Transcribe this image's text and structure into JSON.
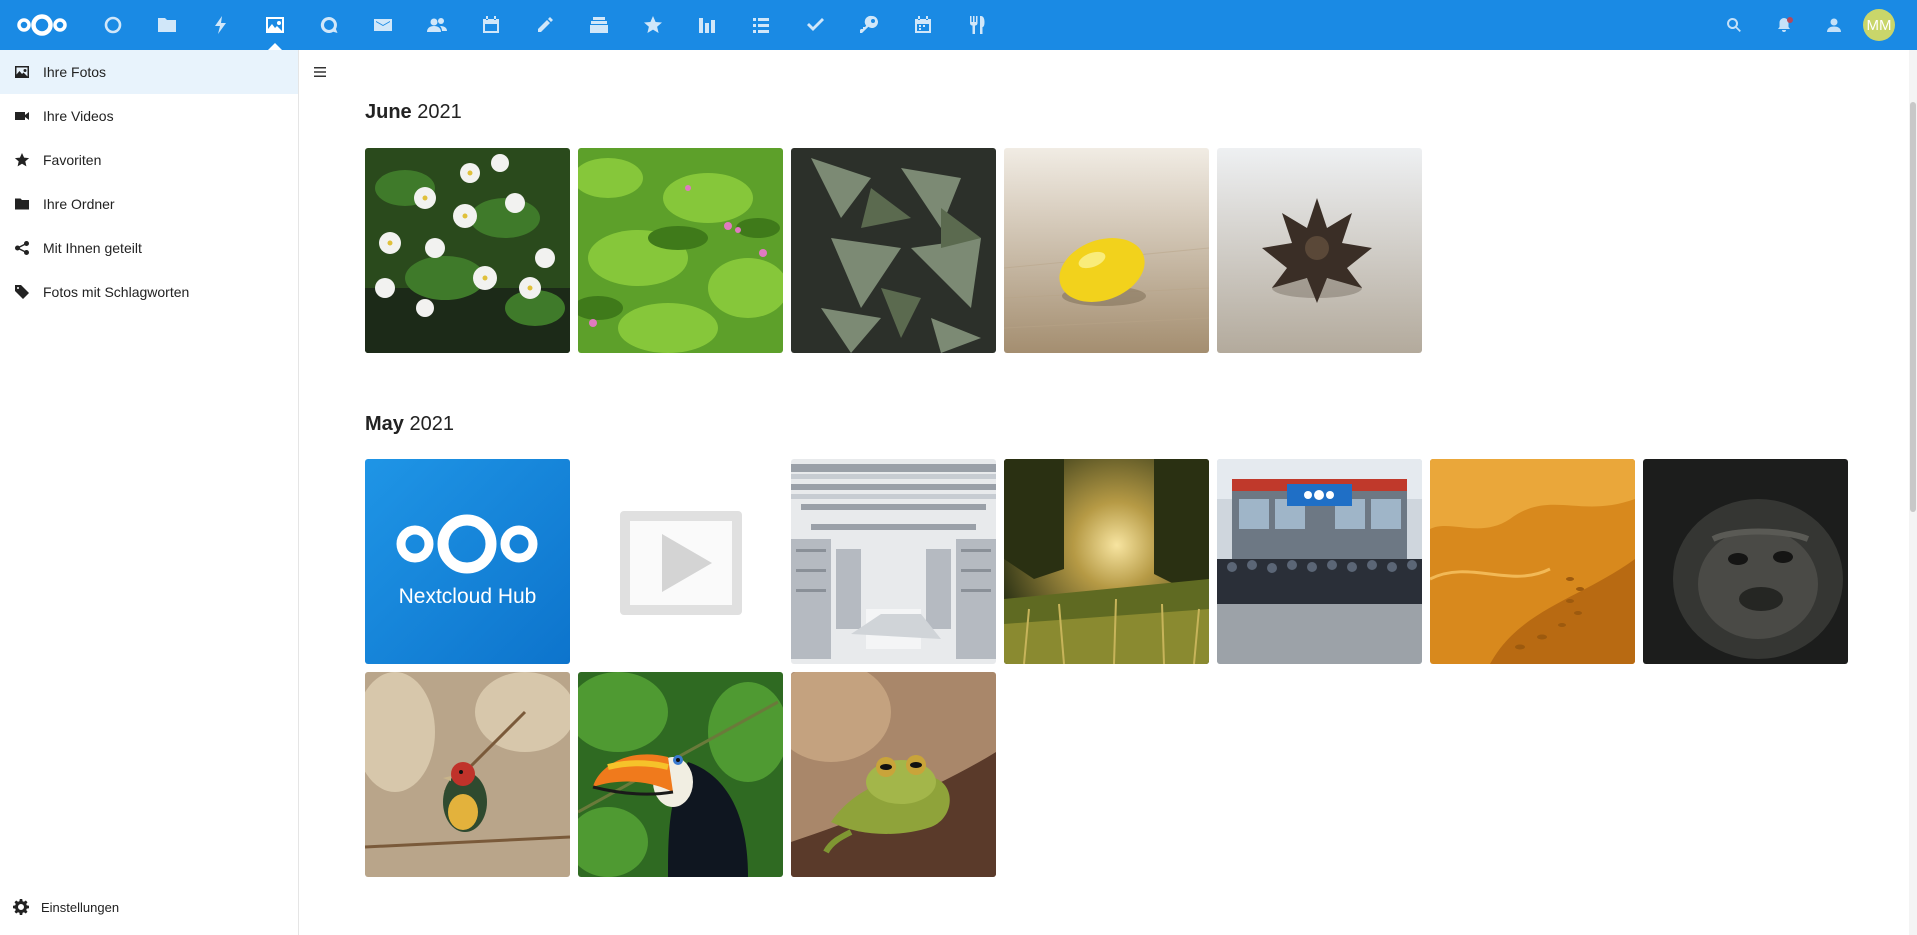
{
  "header": {
    "user_initials": "MM",
    "apps": [
      {
        "name": "dashboard-icon"
      },
      {
        "name": "files-icon"
      },
      {
        "name": "activity-icon"
      },
      {
        "name": "photos-icon"
      },
      {
        "name": "talk-icon"
      },
      {
        "name": "mail-icon"
      },
      {
        "name": "contacts-icon"
      },
      {
        "name": "calendar-icon"
      },
      {
        "name": "notes-icon"
      },
      {
        "name": "deck-icon"
      },
      {
        "name": "bookmarks-icon"
      },
      {
        "name": "analytics-icon"
      },
      {
        "name": "tasks-icon"
      },
      {
        "name": "checklist-icon"
      },
      {
        "name": "passwords-icon"
      },
      {
        "name": "appointments-icon"
      },
      {
        "name": "cookbook-icon"
      }
    ]
  },
  "sidebar": {
    "items": [
      {
        "label": "Ihre Fotos"
      },
      {
        "label": "Ihre Videos"
      },
      {
        "label": "Favoriten"
      },
      {
        "label": "Ihre Ordner"
      },
      {
        "label": "Mit Ihnen geteilt"
      },
      {
        "label": "Fotos mit Schlagworten"
      }
    ],
    "settings_label": "Einstellungen"
  },
  "sections": [
    {
      "month": "June",
      "year": "2021"
    },
    {
      "month": "May",
      "year": "2021"
    }
  ],
  "tile": {
    "nextcloud_text": "Nextcloud Hub"
  },
  "colors": {
    "accent": "#1a8ae4",
    "active_nav": "#e8f3fc"
  }
}
